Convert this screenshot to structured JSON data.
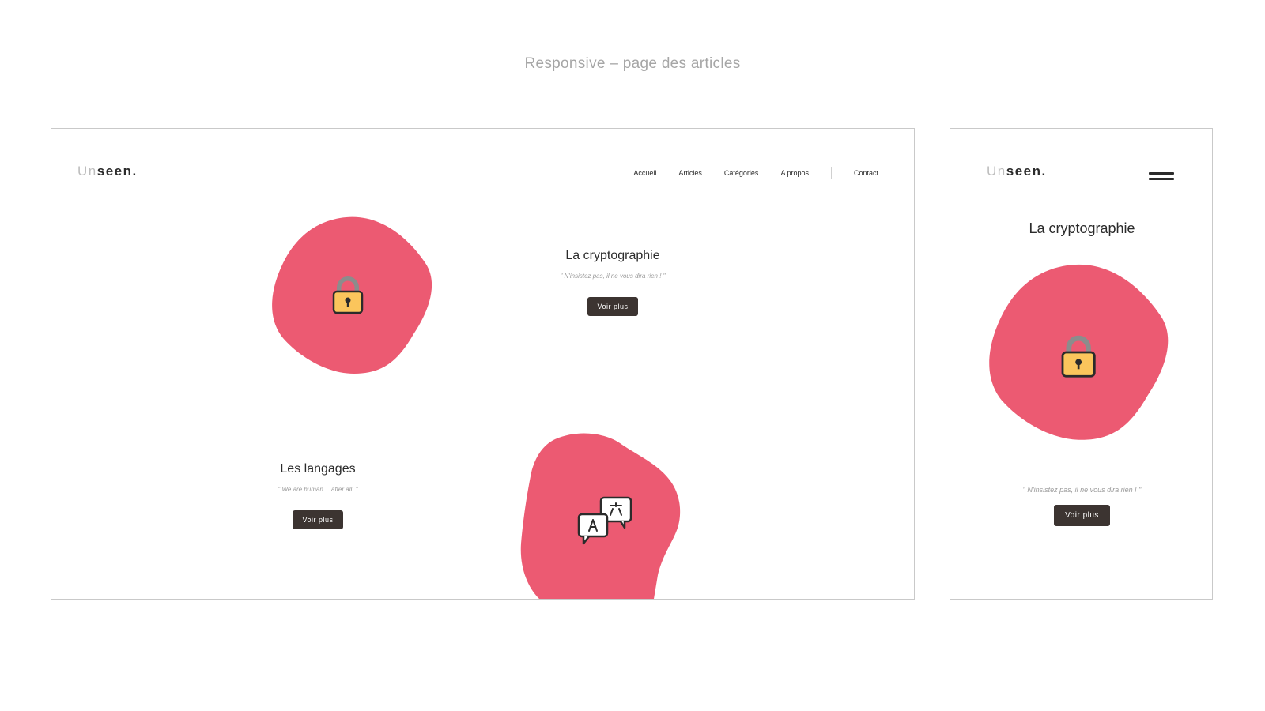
{
  "page_title": "Responsive – page des articles",
  "logo": {
    "light": "Un",
    "dark": "seen",
    "dot": "."
  },
  "nav": {
    "items": [
      "Accueil",
      "Articles",
      "Catégories",
      "A propos"
    ],
    "contact": "Contact"
  },
  "articles": [
    {
      "title": "La cryptographie",
      "quote": "\" N'insistez pas, il ne vous dira rien ! \"",
      "button": "Voir plus",
      "icon": "padlock-icon"
    },
    {
      "title": "Les langages",
      "quote": "\" We are human… after all. \"",
      "button": "Voir plus",
      "icon": "translate-chat-icon"
    }
  ],
  "mobile": {
    "title": "La cryptographie",
    "quote": "\" N'insistez pas, il ne vous dira rien ! \"",
    "button": "Voir plus"
  },
  "colors": {
    "blob": "#ec5a72",
    "button": "#3c3431",
    "lock_body": "#fbc55c",
    "lock_shackle": "#8c8c8c"
  }
}
